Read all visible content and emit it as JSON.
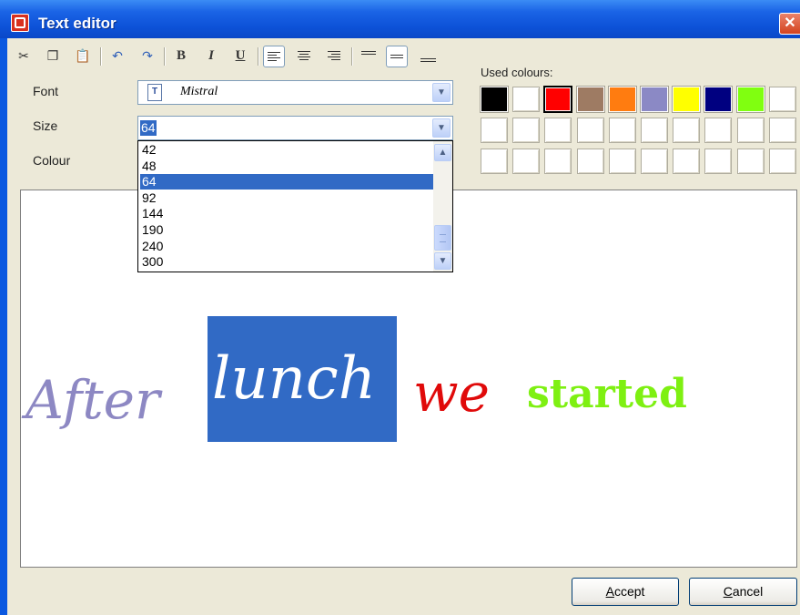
{
  "window": {
    "title": "Text editor"
  },
  "toolbar": {
    "cut_icon": "scissors-icon",
    "copy_icon": "copy-icon",
    "paste_icon": "paste-icon",
    "undo_icon": "undo-icon",
    "redo_icon": "redo-icon",
    "bold_label": "B",
    "italic_label": "I",
    "underline_label": "U"
  },
  "form": {
    "font_label": "Font",
    "font_value": "Mistral",
    "size_label": "Size",
    "size_value": "64",
    "colour_label": "Colour"
  },
  "size_options": [
    "42",
    "48",
    "64",
    "92",
    "144",
    "190",
    "240",
    "300"
  ],
  "size_selected": "64",
  "colours": {
    "label": "Used colours:",
    "swatches_row1": [
      "#000000",
      "#ffffff",
      "#ff0000",
      "#9e7b63",
      "#ff7c10",
      "#8b89c5",
      "#ffff00",
      "#000080",
      "#80ff10",
      "#ffffff"
    ]
  },
  "text_content": {
    "after": "After",
    "lunch": "lunch",
    "we": "we",
    "started": "started"
  },
  "buttons": {
    "accept_key": "A",
    "accept_rest": "ccept",
    "cancel_key": "C",
    "cancel_rest": "ancel"
  }
}
